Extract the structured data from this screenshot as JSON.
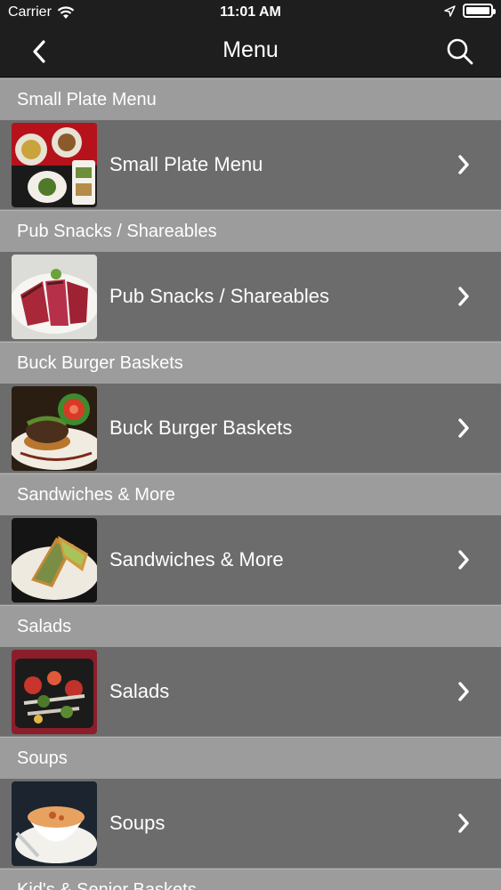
{
  "status": {
    "carrier": "Carrier",
    "time": "11:01 AM"
  },
  "nav": {
    "title": "Menu"
  },
  "sections": [
    {
      "header": "Small Plate Menu",
      "item": "Small Plate Menu"
    },
    {
      "header": "Pub Snacks / Shareables",
      "item": "Pub Snacks / Shareables"
    },
    {
      "header": "Buck Burger Baskets",
      "item": "Buck Burger Baskets"
    },
    {
      "header": "Sandwiches & More",
      "item": "Sandwiches & More"
    },
    {
      "header": "Salads",
      "item": "Salads"
    },
    {
      "header": "Soups",
      "item": "Soups"
    },
    {
      "header": "Kid's & Senior Baskets"
    }
  ],
  "icons": {
    "wifi": "wifi-icon",
    "location": "location-arrow-icon",
    "battery": "battery-icon",
    "back": "chevron-left-icon",
    "search": "search-icon",
    "row_chevron": "chevron-right-icon"
  }
}
